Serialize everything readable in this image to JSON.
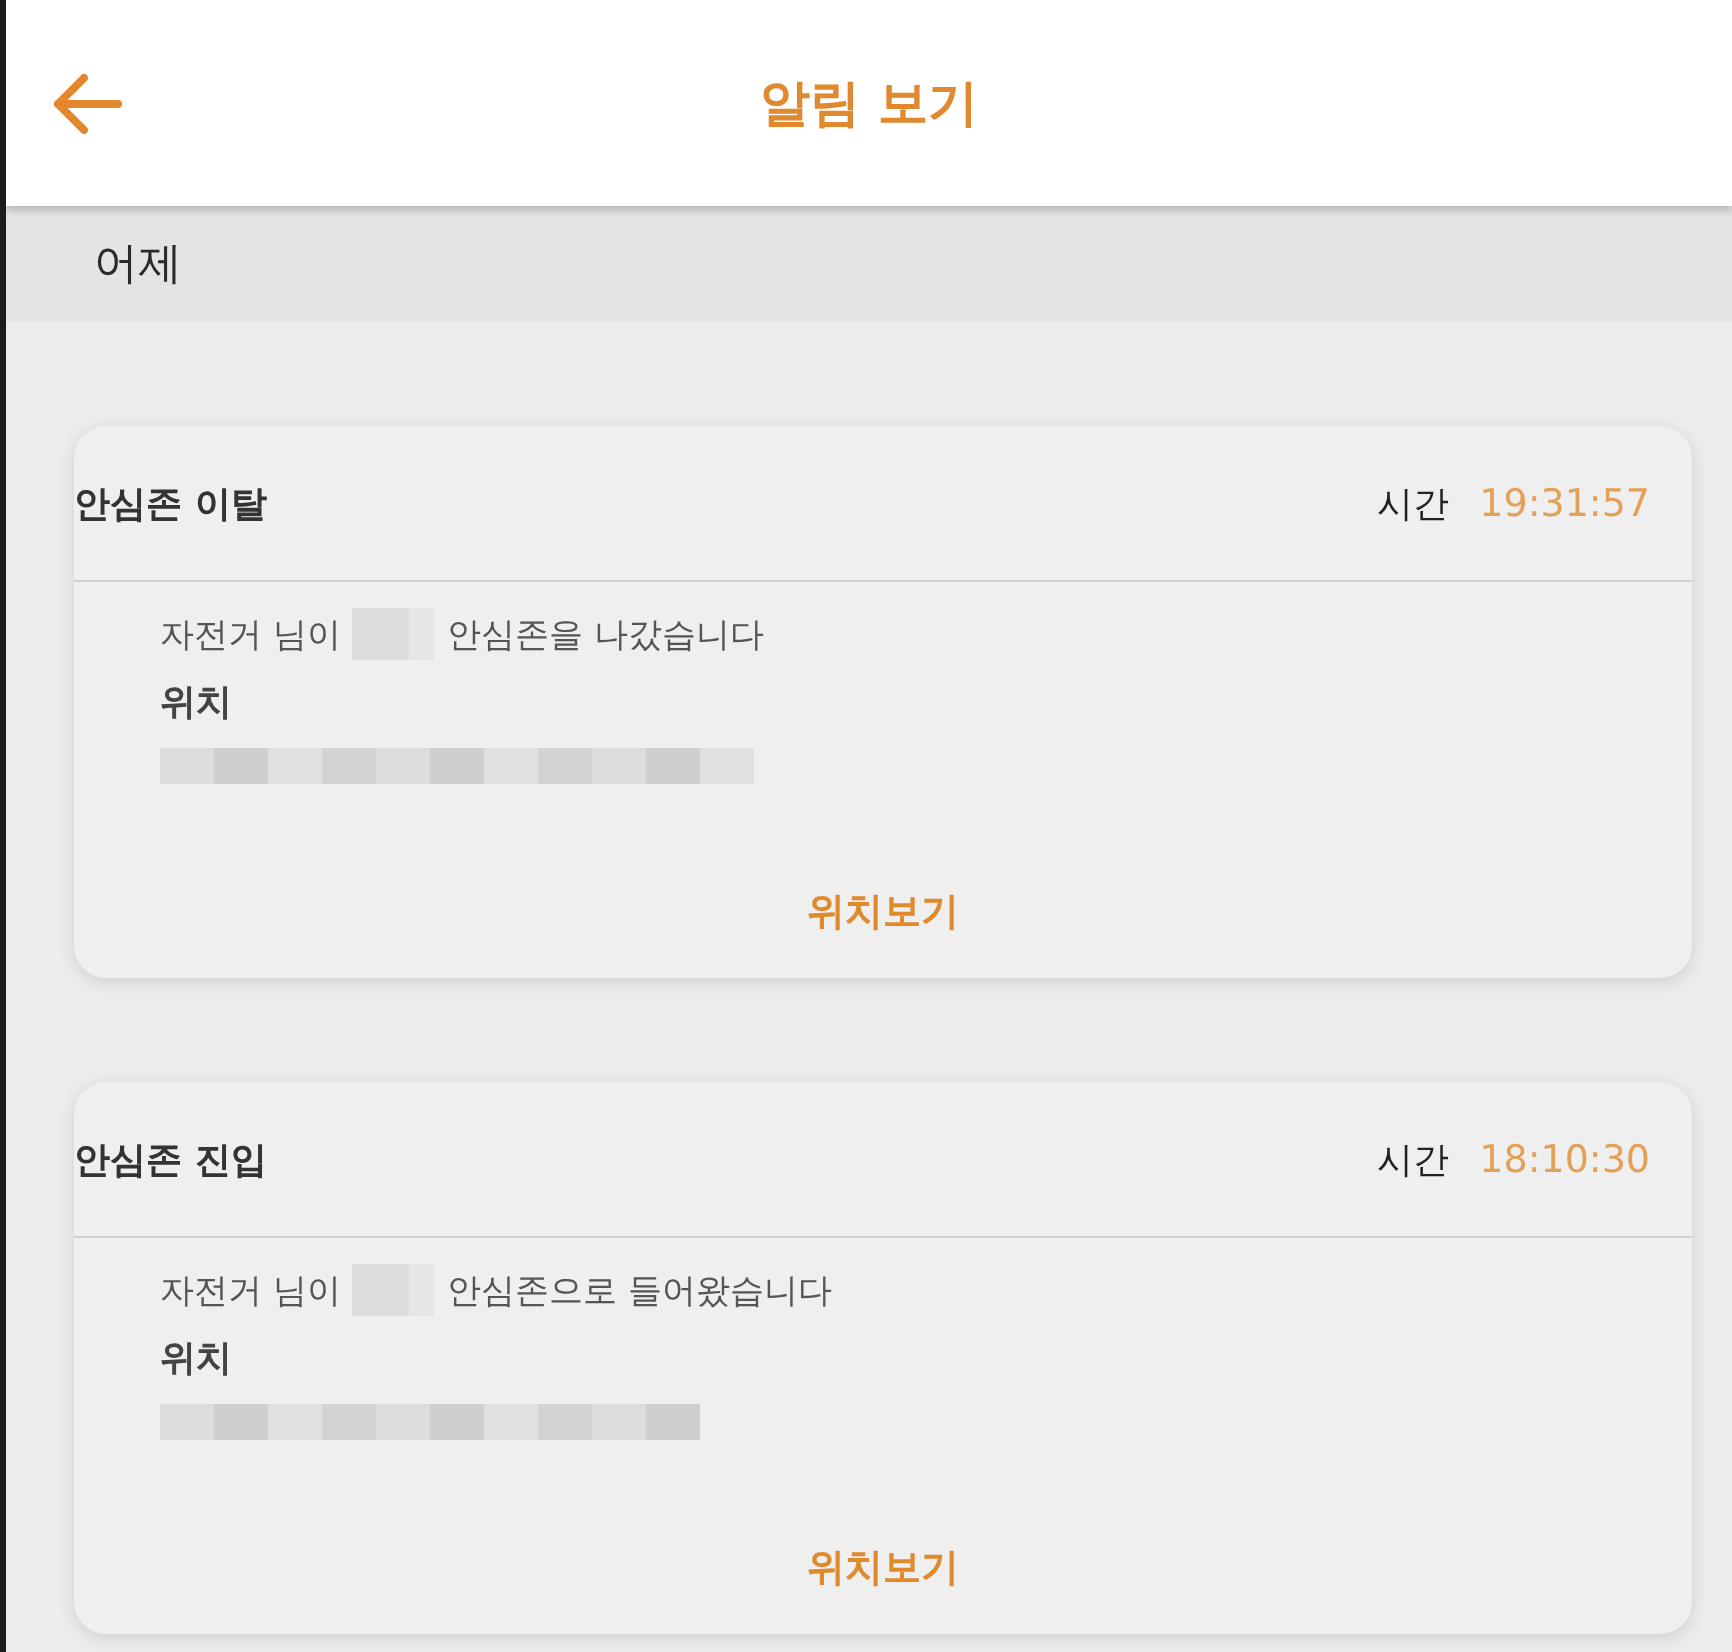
{
  "header": {
    "title": "알림 보기"
  },
  "section": {
    "label": "어제"
  },
  "notifications": [
    {
      "title": "안심존 이탈",
      "time_label": "시간",
      "time": "19:31:57",
      "message_before": "자전거 님이",
      "message_after": "안심존을 나갔습니다",
      "location_label": "위치",
      "action": "위치보기"
    },
    {
      "title": "안심존 진입",
      "time_label": "시간",
      "time": "18:10:30",
      "message_before": "자전거 님이",
      "message_after": "안심존으로 들어왔습니다",
      "location_label": "위치",
      "action": "위치보기"
    }
  ]
}
